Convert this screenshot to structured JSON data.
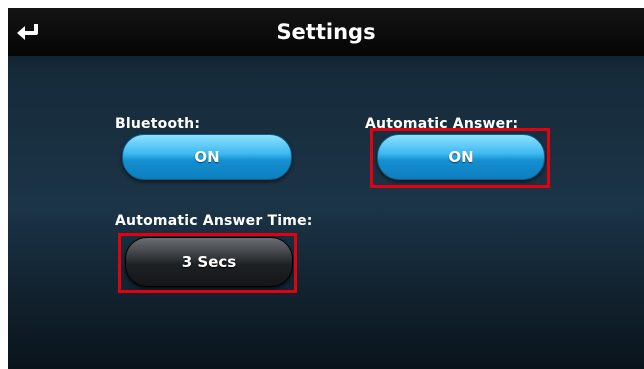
{
  "header": {
    "title": "Settings",
    "back_icon": "return-arrow-icon"
  },
  "settings": {
    "bluetooth": {
      "label": "Bluetooth:",
      "value": "ON"
    },
    "automatic_answer": {
      "label": "Automatic Answer:",
      "value": "ON"
    },
    "automatic_answer_time": {
      "label": "Automatic Answer Time:",
      "value": "3 Secs"
    }
  },
  "colors": {
    "toggle_blue": "#3dbaf0",
    "highlight_red": "#e3000f",
    "background_navy": "#1b3447"
  }
}
